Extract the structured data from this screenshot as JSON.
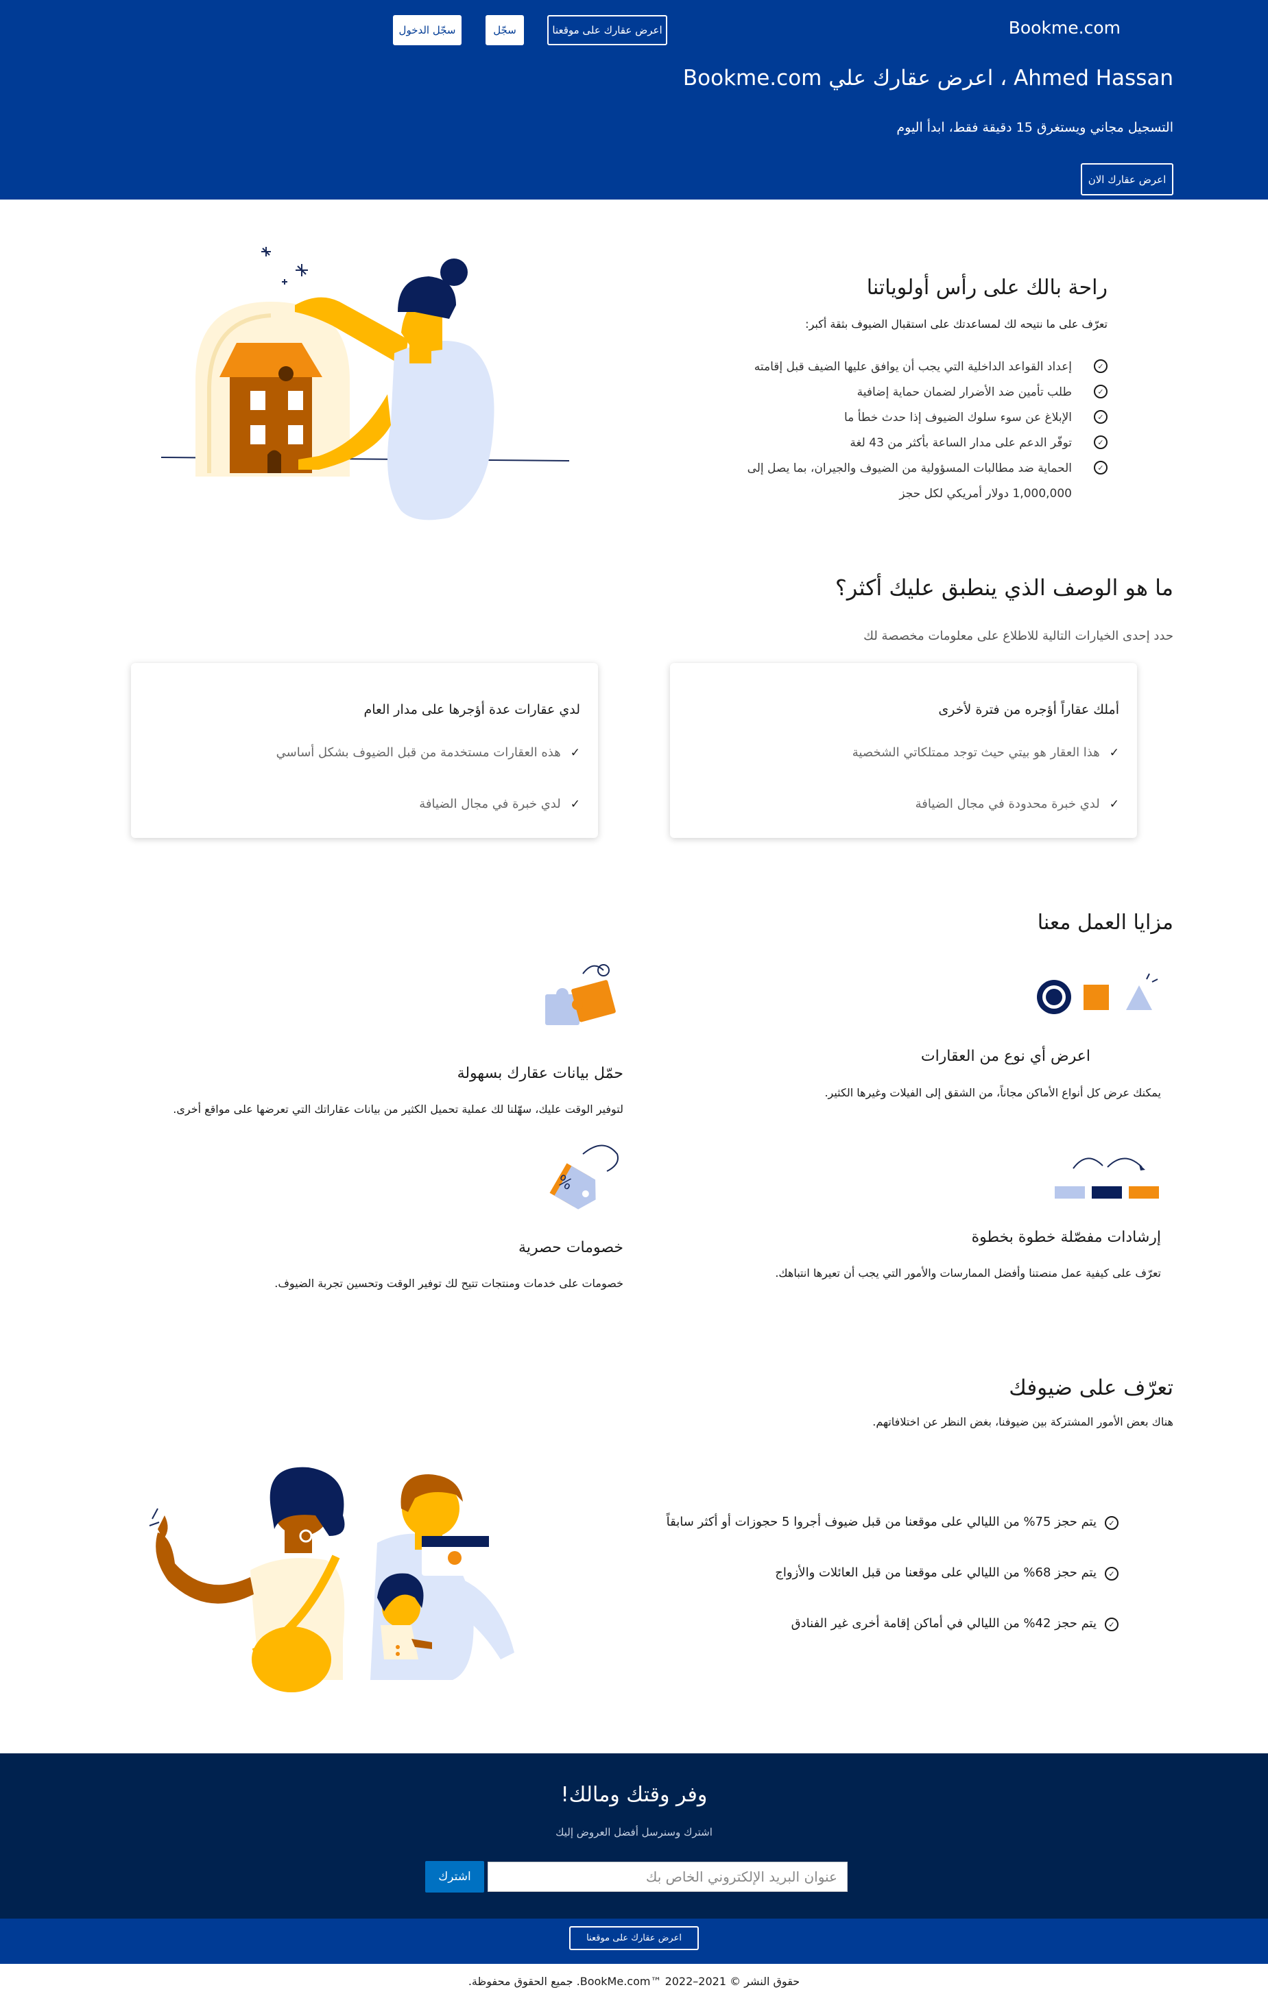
{
  "header": {
    "brand": "Bookme.com",
    "list_on_site_label": "اعرض عقارك على موقعنا",
    "register_label": "سجّل",
    "login_label": "سجّل الدخول",
    "hero_title": "Ahmed Hassan ، اعرض عقارك علي Bookme.com",
    "hero_subtitle": "التسجيل مجاني ويستغرق 15 دقيقة فقط، ابدأ اليوم",
    "hero_cta": "اعرض عقارك الان"
  },
  "priorities": {
    "title": "راحة بالك على رأس أولوياتنا",
    "intro": "تعرّف على ما نتيحه لك لمساعدتك على استقبال الضيوف بثقة أكبر:",
    "items": [
      "إعداد القواعد الداخلية التي يجب أن يوافق عليها الضيف قبل إقامته",
      "طلب تأمين ضد الأضرار لضمان حماية إضافية",
      "الإبلاغ عن سوء سلوك الضيوف إذا حدث خطأ ما",
      "توفّر الدعم على مدار الساعة بأكثر من 43 لغة",
      "الحماية ضد مطالبات المسؤولية من الضيوف والجيران، بما يصل إلى"
    ],
    "items_continuation": "1,000,000 دولار أمريكي لكل حجز"
  },
  "describe": {
    "title": "ما هو الوصف الذي ينطبق عليك أكثر؟",
    "subtitle": "حدد إحدى الخيارات التالية للاطلاع على معلومات مخصصة لك",
    "cards": [
      {
        "title": "أملك عقاراً أؤجره من فترة لأخرى",
        "items": [
          "هذا العقار هو بيتي حيث توجد ممتلكاتي الشخصية",
          "لدي خبرة محدودة في مجال الضيافة"
        ]
      },
      {
        "title": "لدي عقارات عدة أؤجرها على مدار العام",
        "items": [
          "هذه العقارات مستخدمة من قبل الضيوف بشكل أساسي",
          "لدي خبرة في مجال الضيافة"
        ]
      }
    ]
  },
  "benefits": {
    "title": "مزايا العمل معنا",
    "features": [
      {
        "title": "اعرض أي نوع من العقارات",
        "desc": "يمكنك عرض كل أنواع الأماكن مجاناً، من الشقق إلى الفيلات وغيرها الكثير."
      },
      {
        "title": "حمّل بيانات عقارك بسهولة",
        "desc": "لتوفير الوقت عليك، سهّلنا لك عملية تحميل الكثير من بيانات عقاراتك التي تعرضها على مواقع أخرى."
      },
      {
        "title": "إرشادات مفصّلة خطوة بخطوة",
        "desc": "تعرّف على كيفية عمل منصتنا وأفضل الممارسات والأمور التي يجب أن تعيرها انتباهك."
      },
      {
        "title": "خصومات حصرية",
        "desc": "خصومات على خدمات ومنتجات تتيح لك توفير الوقت وتحسين تجربة الضيوف."
      }
    ]
  },
  "guests": {
    "title": "تعرّف على ضيوفك",
    "subtitle": "هناك بعض الأمور المشتركة بين ضيوفنا، بغض النظر عن اختلافاتهم.",
    "stats": [
      "يتم حجز 75% من الليالي على موقعنا من قبل ضيوف أجروا 5 حجوزات أو أكثر سابقاً",
      "يتم حجز 68% من الليالي على موقعنا من قبل العائلات والأزواج",
      "يتم حجز 42% من الليالي في أماكن إقامة أخرى غير الفنادق"
    ]
  },
  "newsletter": {
    "title": "وفر وقتك ومالك!",
    "subtitle": "اشترك وسنرسل أفضل العروض إليك",
    "email_placeholder": "عنوان البريد الإلكتروني الخاص بك",
    "subscribe_label": "اشترك"
  },
  "footer": {
    "list_button": "اعرض عقارك على موقعنا",
    "copyright": "حقوق النشر © 2021–2022 ™BookMe.com. جميع الحقوق محفوظة."
  },
  "colors": {
    "brand_blue": "#003b95",
    "dark_navy": "#00224f",
    "accent_orange": "#f28c0f",
    "accent_yellow": "#ffb700",
    "cta_blue": "#0071c2"
  }
}
